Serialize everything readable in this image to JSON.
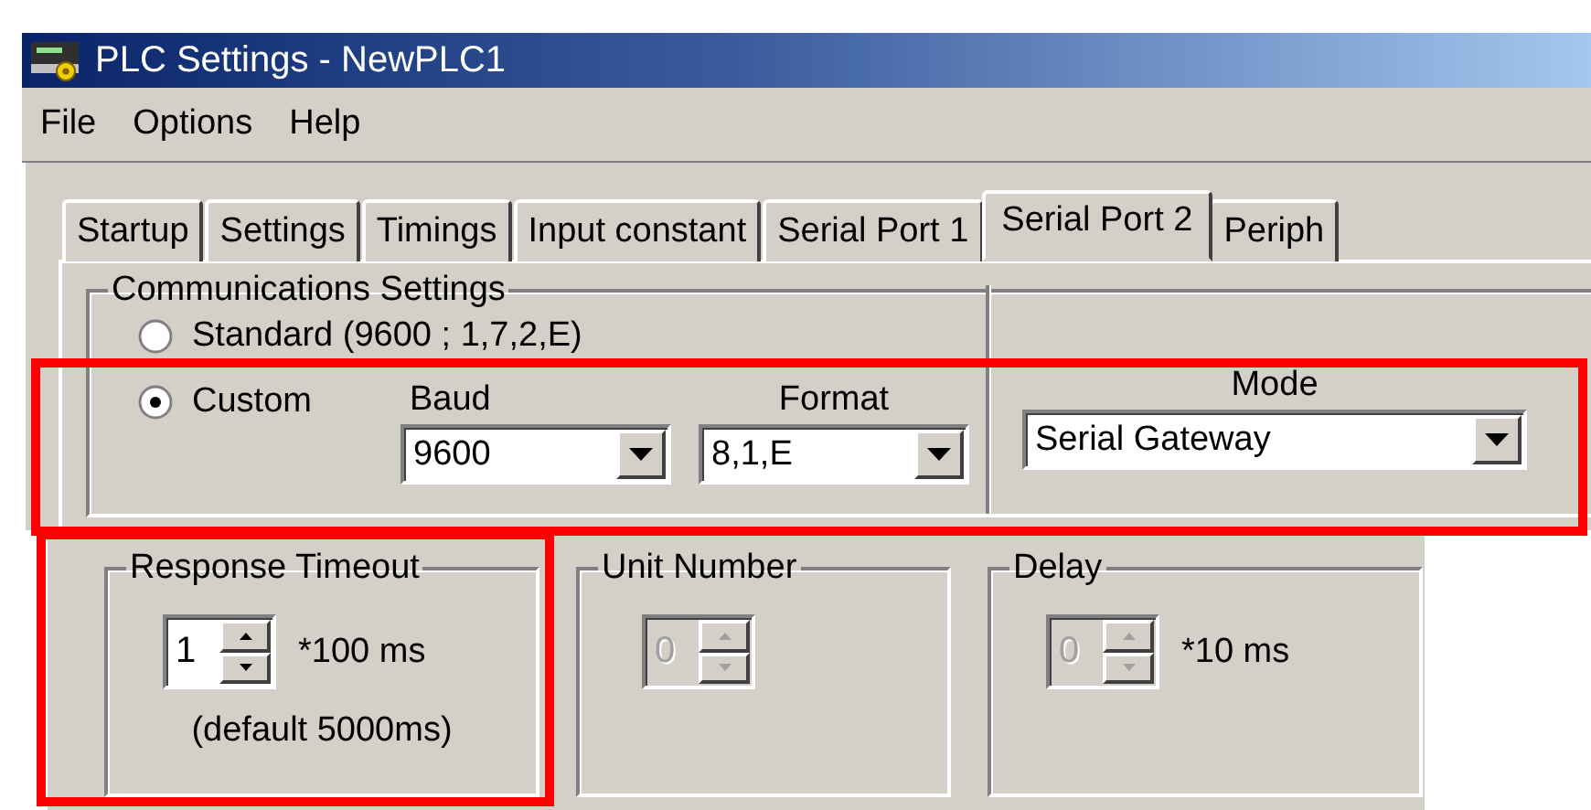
{
  "window": {
    "title": "PLC Settings - NewPLC1"
  },
  "menu": [
    "File",
    "Options",
    "Help"
  ],
  "tabs": [
    {
      "label": "Startup",
      "selected": false
    },
    {
      "label": "Settings",
      "selected": false
    },
    {
      "label": "Timings",
      "selected": false
    },
    {
      "label": "Input constant",
      "selected": false
    },
    {
      "label": "Serial Port 1",
      "selected": false
    },
    {
      "label": "Serial Port 2",
      "selected": true
    },
    {
      "label": "Periph",
      "selected": false
    }
  ],
  "communications": {
    "title": "Communications Settings",
    "options": [
      {
        "label": "Standard (9600 ; 1,7,2,E)",
        "selected": false
      },
      {
        "label": "Custom",
        "selected": true
      }
    ],
    "baud": {
      "label": "Baud",
      "value": "9600"
    },
    "format": {
      "label": "Format",
      "value": "8,1,E"
    },
    "mode": {
      "label": "Mode",
      "value": "Serial Gateway"
    }
  },
  "groups": [
    {
      "title": "Response Timeout",
      "value": "1",
      "unit": "*100 ms",
      "note": "(default 5000ms)",
      "disabled": false
    },
    {
      "title": "Unit Number",
      "value": "0",
      "disabled": true
    },
    {
      "title": "Delay",
      "value": "0",
      "unit": "*10 ms",
      "disabled": true
    }
  ],
  "highlights": [
    {
      "kind": "frame",
      "color": "#ff0000"
    },
    {
      "kind": "frame",
      "color": "#ff0000"
    }
  ]
}
